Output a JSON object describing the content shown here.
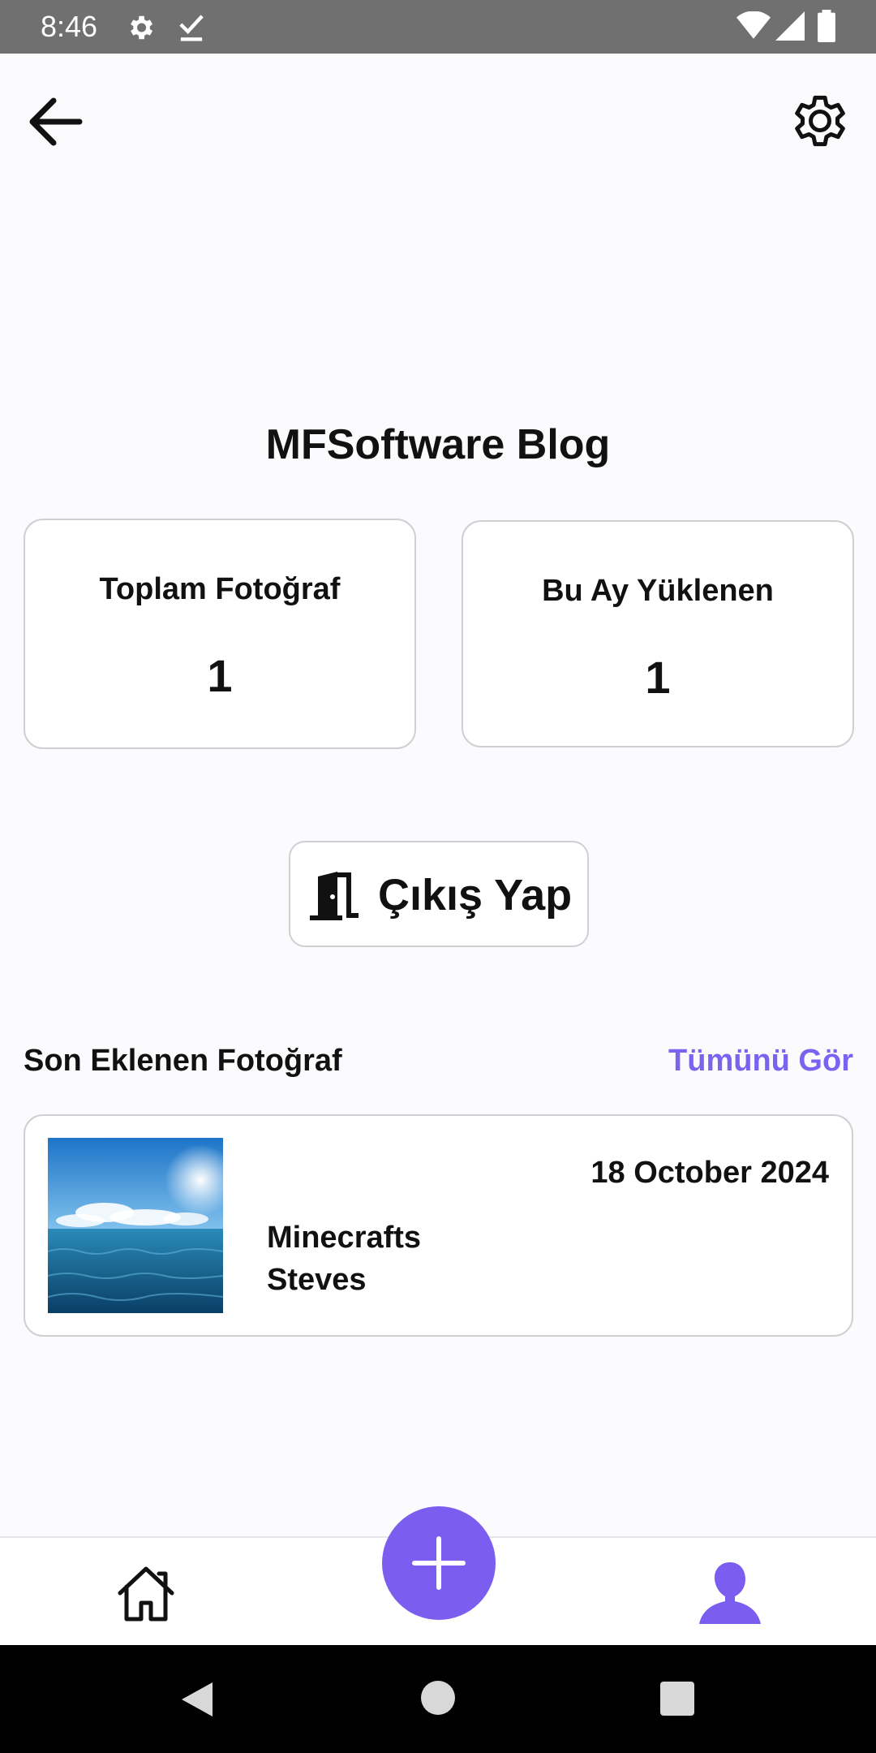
{
  "status_bar": {
    "time": "8:46",
    "icons": [
      "gear-icon",
      "check-icon",
      "wifi-icon",
      "signal-icon",
      "battery-icon"
    ]
  },
  "header": {
    "back_icon": "arrow-left-icon",
    "settings_icon": "gear-icon"
  },
  "profile": {
    "title": "MFSoftware Blog"
  },
  "stats": [
    {
      "label": "Toplam Fotoğraf",
      "value": "1"
    },
    {
      "label": "Bu Ay Yüklenen",
      "value": "1"
    }
  ],
  "logout": {
    "icon": "door-exit-icon",
    "label": "Çıkış Yap"
  },
  "recent": {
    "section_title": "Son Eklenen Fotoğraf",
    "see_all": "Tümünü Gör",
    "item": {
      "date": "18 October 2024",
      "title": "Minecrafts",
      "author": "Steves",
      "thumbnail": "sea-and-sky-photo"
    }
  },
  "bottom_nav": {
    "items": [
      "home-icon",
      "add-icon",
      "profile-icon"
    ],
    "active": "profile-icon"
  },
  "colors": {
    "accent": "#7b5df0",
    "link": "#7b63ef",
    "status_bar": "#707070",
    "background": "#fbfbfd"
  }
}
